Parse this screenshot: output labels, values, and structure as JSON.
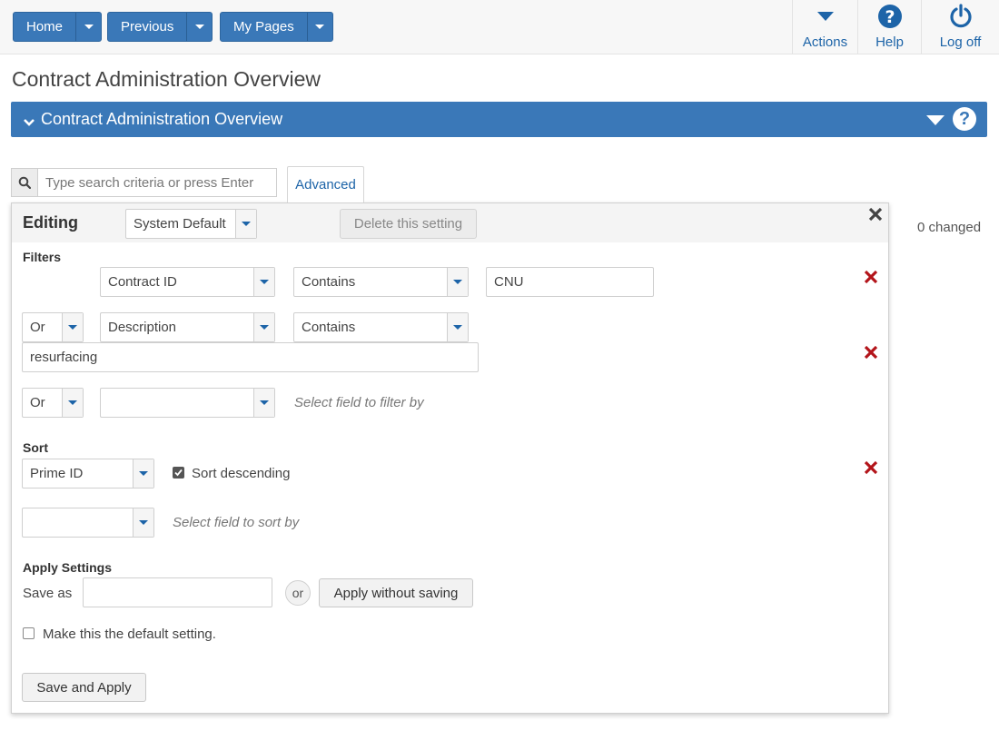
{
  "nav": {
    "home": "Home",
    "previous": "Previous",
    "my_pages": "My Pages",
    "actions": "Actions",
    "help": "Help",
    "logoff": "Log off"
  },
  "page_title": "Contract Administration Overview",
  "panel_title": "Contract Administration Overview",
  "search": {
    "placeholder": "Type search criteria or press Enter",
    "advanced": "Advanced"
  },
  "changed_text": "0 changed",
  "editing": {
    "title": "Editing",
    "setting_select": "System Default",
    "delete_setting": "Delete this setting",
    "filters_label": "Filters",
    "filters": [
      {
        "connector": "",
        "field": "Contract ID",
        "operator": "Contains",
        "value": "CNU"
      },
      {
        "connector": "Or",
        "field": "Description",
        "operator": "Contains",
        "value": "resurfacing"
      },
      {
        "connector": "Or",
        "field": "",
        "hint": "Select field to filter by"
      }
    ],
    "sort_label": "Sort",
    "sort": [
      {
        "field": "Prime ID",
        "descending_label": "Sort descending",
        "descending": true
      },
      {
        "field": "",
        "hint": "Select field to sort by"
      }
    ],
    "apply_label": "Apply Settings",
    "save_as_label": "Save as",
    "save_as_value": "",
    "or_label": "or",
    "apply_without_saving": "Apply without saving",
    "default_label": "Make this the default setting.",
    "save_and_apply": "Save and Apply"
  },
  "colors": {
    "primary": "#3a78b8",
    "link": "#1d64a8",
    "delete": "#b3141a"
  }
}
